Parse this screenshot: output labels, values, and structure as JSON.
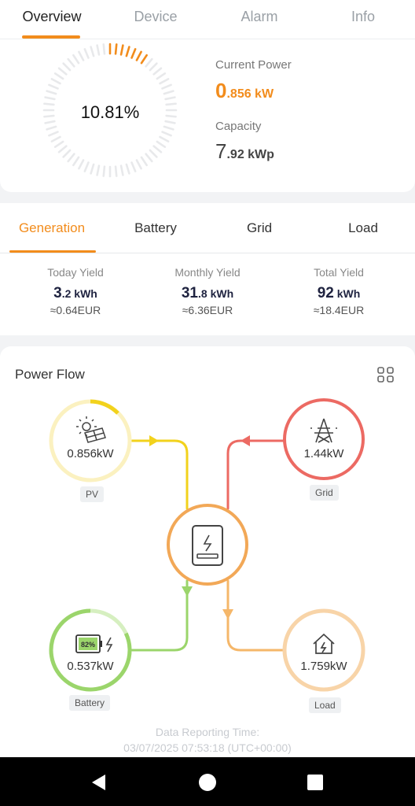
{
  "tabs": [
    "Overview",
    "Device",
    "Alarm",
    "Info"
  ],
  "overview": {
    "percent": "10.81%",
    "current_power_label": "Current Power",
    "current_power_int": "0",
    "current_power_dec": ".856 kW",
    "capacity_label": "Capacity",
    "capacity_int": "7",
    "capacity_dec": ".92 kWp"
  },
  "sub_tabs": [
    "Generation",
    "Battery",
    "Grid",
    "Load"
  ],
  "yields": [
    {
      "label": "Today Yield",
      "int": "3",
      "dec": ".2 kWh",
      "eur": "≈0.64EUR"
    },
    {
      "label": "Monthly Yield",
      "int": "31",
      "dec": ".8 kWh",
      "eur": "≈6.36EUR"
    },
    {
      "label": "Total Yield",
      "int": "92",
      "dec": " kWh",
      "eur": "≈18.4EUR"
    }
  ],
  "power_flow": {
    "title": "Power Flow",
    "pv": {
      "value": "0.856kW",
      "tag": "PV"
    },
    "grid": {
      "value": "1.44kW",
      "tag": "Grid"
    },
    "battery": {
      "value": "0.537kW",
      "tag": "Battery",
      "soc": "82%"
    },
    "load": {
      "value": "1.759kW",
      "tag": "Load"
    },
    "report_label": "Data Reporting Time:",
    "report_time": "03/07/2025 07:53:18 (UTC+00:00)"
  },
  "colors": {
    "accent": "#f28c1c",
    "pv": "#f2d21c",
    "grid": "#ec6a63",
    "battery": "#9bd56b",
    "load": "#f5b76a"
  },
  "icons": [
    "sun-panel-icon",
    "pylon-icon",
    "inverter-icon",
    "battery-icon",
    "house-icon",
    "layout-icon"
  ]
}
